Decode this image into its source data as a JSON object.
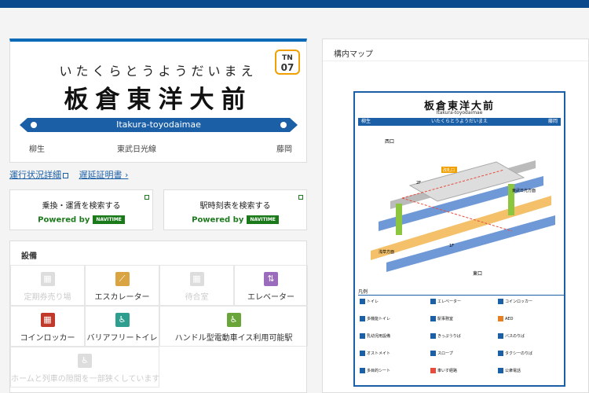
{
  "station": {
    "reading": "いたくらとうようだいまえ",
    "name": "板倉東洋大前",
    "number_line": "TN",
    "number": "07",
    "romaji": "Itakura-toyodaimae",
    "prev": "柳生",
    "line": "東武日光線",
    "next": "藤岡"
  },
  "links": {
    "status": "運行状況詳細",
    "certificate": "遅延証明書"
  },
  "search": {
    "fare": "乗換・運賃を検索する",
    "timetable": "駅時刻表を検索する",
    "powered": "Powered by",
    "navitime": "NAVITIME"
  },
  "facility": {
    "heading": "設備",
    "items": [
      {
        "label": "定期券売り場",
        "icon": "ticket-office-icon",
        "enabled": false
      },
      {
        "label": "エスカレーター",
        "icon": "escalator-icon",
        "enabled": true,
        "color": "#d9a441"
      },
      {
        "label": "待合室",
        "icon": "waiting-room-icon",
        "enabled": false
      },
      {
        "label": "エレベーター",
        "icon": "elevator-icon",
        "enabled": true,
        "color": "#9b6bbd"
      },
      {
        "label": "コインロッカー",
        "icon": "coin-locker-icon",
        "enabled": true,
        "color": "#c0392b"
      },
      {
        "label": "バリアフリートイレ",
        "icon": "accessible-toilet-icon",
        "enabled": true,
        "color": "#2e9e8f"
      },
      {
        "label": "ハンドル型電動車イス利用可能駅",
        "icon": "electric-wheelchair-icon",
        "enabled": true,
        "color": "#6aa53a"
      },
      {
        "label": "ホームと列車の隙間を一部狭くしています",
        "icon": "platform-gap-icon",
        "enabled": false
      }
    ]
  },
  "map": {
    "heading": "構内マップ",
    "title": "板倉東洋大前",
    "romaji": "Itakura-toyodaimae",
    "bar_left": "柳生",
    "bar_center": "いたくらとうようだいまえ",
    "bar_right": "藤岡",
    "west_exit": "西口",
    "east_exit": "東口",
    "gate": "改札口",
    "to_tobu_nikko": "東武日光方面",
    "to_asakusa": "浅草方面",
    "legend_title": "凡例",
    "legend": [
      {
        "label": "トイレ",
        "color": "#1b5fa6"
      },
      {
        "label": "エレベーター",
        "color": "#1b5fa6"
      },
      {
        "label": "コインロッカー",
        "color": "#1b5fa6"
      },
      {
        "label": "多機能トイレ",
        "color": "#1b5fa6"
      },
      {
        "label": "駅事務室",
        "color": "#1b5fa6"
      },
      {
        "label": "AED",
        "color": "#e67e22"
      },
      {
        "label": "乳幼児用設備",
        "color": "#1b5fa6"
      },
      {
        "label": "きっぷうりば",
        "color": "#1b5fa6"
      },
      {
        "label": "バスのりば",
        "color": "#1b5fa6"
      },
      {
        "label": "オストメイト",
        "color": "#1b5fa6"
      },
      {
        "label": "スロープ",
        "color": "#1b5fa6"
      },
      {
        "label": "タクシーのりば",
        "color": "#1b5fa6"
      },
      {
        "label": "多目的シート",
        "color": "#1b5fa6"
      },
      {
        "label": "車いす経路",
        "color": "#e74c3c"
      },
      {
        "label": "公衆電話",
        "color": "#1b5fa6"
      }
    ]
  }
}
